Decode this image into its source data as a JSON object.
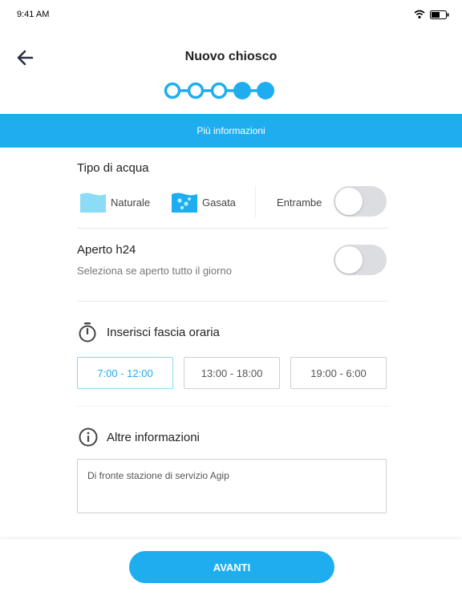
{
  "status_bar": {
    "time": "9:41 AM"
  },
  "header": {
    "title": "Nuovo chiosco",
    "stepper": {
      "total_steps": 5,
      "completed_steps": 3,
      "current_step": 4
    }
  },
  "banner": {
    "text": "Più informazioni"
  },
  "water_type": {
    "label": "Tipo di acqua",
    "options": [
      {
        "label": "Naturale",
        "icon": "still-water-icon"
      },
      {
        "label": "Gasata",
        "icon": "sparkling-water-icon"
      }
    ],
    "both_label": "Entrambe",
    "both_enabled": false
  },
  "open_24h": {
    "label": "Aperto h24",
    "subtext": "Seleziona se aperto tutto il giorno",
    "enabled": false
  },
  "time_slots": {
    "label": "Inserisci fascia oraria",
    "icon": "timer-icon",
    "slots": [
      {
        "label": "7:00 - 12:00",
        "selected": true
      },
      {
        "label": "13:00 - 18:00",
        "selected": false
      },
      {
        "label": "19:00 - 6:00",
        "selected": false
      }
    ]
  },
  "other_info": {
    "label": "Altre informazioni",
    "icon": "info-icon",
    "value": "Di fronte stazione di servizio Agip"
  },
  "footer": {
    "button_label": "AVANTI"
  },
  "colors": {
    "accent": "#1eaef0",
    "water_light": "#8cdcf8",
    "toggle_off": "#dcdde1"
  }
}
